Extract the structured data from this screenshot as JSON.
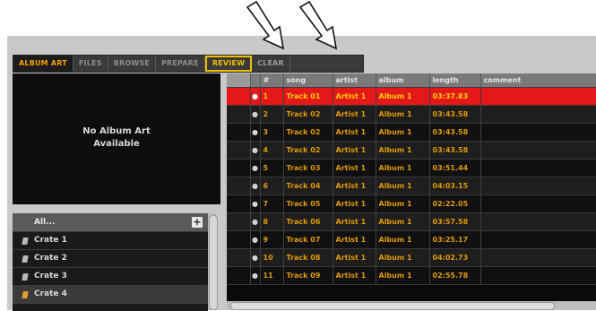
{
  "tabs": [
    {
      "label": "ALBUM ART",
      "state": "active"
    },
    {
      "label": "FILES",
      "state": ""
    },
    {
      "label": "BROWSE",
      "state": ""
    },
    {
      "label": "PREPARE",
      "state": ""
    },
    {
      "label": "REVIEW",
      "state": "highlighted"
    },
    {
      "label": "CLEAR",
      "state": ""
    }
  ],
  "album_art": {
    "line1": "No Album Art",
    "line2": "Available"
  },
  "crates": {
    "all_label": "All...",
    "add_button": "+",
    "items": [
      {
        "label": "Crate 1"
      },
      {
        "label": "Crate 2"
      },
      {
        "label": "Crate 3"
      },
      {
        "label": "Crate 4"
      }
    ]
  },
  "table": {
    "columns": [
      "#",
      "song",
      "artist",
      "album",
      "length",
      "comment"
    ],
    "rows": [
      {
        "n": "1",
        "song": "Track 01",
        "artist": "Artist 1",
        "album": "Album 1",
        "length": "03:37.83",
        "comment": "",
        "selected": true
      },
      {
        "n": "2",
        "song": "Track 02",
        "artist": "Artist 1",
        "album": "Album 1",
        "length": "03:43.58",
        "comment": ""
      },
      {
        "n": "3",
        "song": "Track 02",
        "artist": "Artist 1",
        "album": "Album 1",
        "length": "03:43.58",
        "comment": ""
      },
      {
        "n": "4",
        "song": "Track 02",
        "artist": "Artist 1",
        "album": "Album 1",
        "length": "03:43.58",
        "comment": ""
      },
      {
        "n": "5",
        "song": "Track 03",
        "artist": "Artist 1",
        "album": "Album 1",
        "length": "03:51.44",
        "comment": ""
      },
      {
        "n": "6",
        "song": "Track 04",
        "artist": "Artist 1",
        "album": "Album 1",
        "length": "04:03.15",
        "comment": ""
      },
      {
        "n": "7",
        "song": "Track 05",
        "artist": "Artist 1",
        "album": "Album 1",
        "length": "02:22.05",
        "comment": ""
      },
      {
        "n": "8",
        "song": "Track 06",
        "artist": "Artist 1",
        "album": "Album 1",
        "length": "03:57.58",
        "comment": ""
      },
      {
        "n": "9",
        "song": "Track 07",
        "artist": "Artist 1",
        "album": "Album 1",
        "length": "03:25.17",
        "comment": ""
      },
      {
        "n": "10",
        "song": "Track 08",
        "artist": "Artist 1",
        "album": "Album 1",
        "length": "04:02.73",
        "comment": ""
      },
      {
        "n": "11",
        "song": "Track 09",
        "artist": "Artist 1",
        "album": "Album 1",
        "length": "02:55.78",
        "comment": ""
      }
    ]
  },
  "colors": {
    "accent": "#f0a000",
    "selected_row": "#e41818",
    "background": "#0a0a0a"
  },
  "icons": [
    "down-arrow-icon",
    "crate-icon",
    "add-icon"
  ]
}
